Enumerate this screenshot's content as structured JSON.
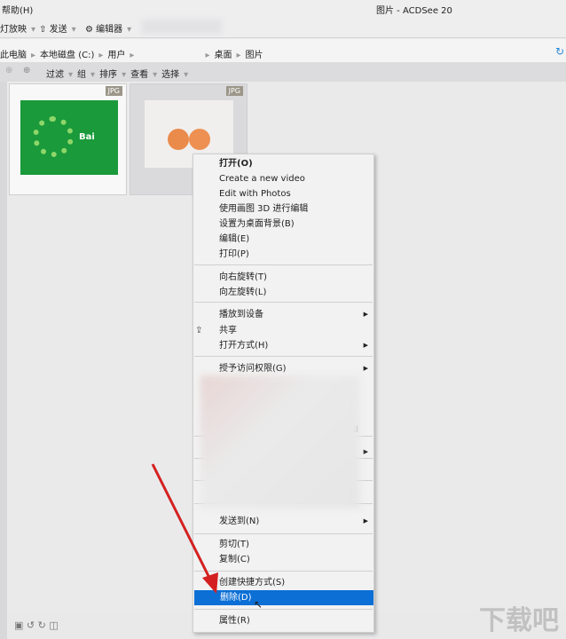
{
  "menubar": {
    "help": "帮助(H)",
    "title": "图片 - ACDSee 20"
  },
  "toolbar": {
    "slideshow": "灯放映",
    "send": "发送",
    "editor": "编辑器"
  },
  "breadcrumb": [
    "此电脑",
    "本地磁盘 (C:)",
    "用户",
    "桌面",
    "图片"
  ],
  "subtoolbar": [
    "过滤",
    "组",
    "排序",
    "查看",
    "选择"
  ],
  "thumbnails": [
    {
      "badge": "JPG",
      "logo": "Bai"
    },
    {
      "badge": "JPG"
    }
  ],
  "context_menu": {
    "items": [
      {
        "label": "打开(O)",
        "bold": true
      },
      {
        "label": "Create a new video"
      },
      {
        "label": "Edit with Photos"
      },
      {
        "label": "使用画图 3D 进行编辑"
      },
      {
        "label": "设置为桌面背景(B)"
      },
      {
        "label": "编辑(E)"
      },
      {
        "label": "打印(P)"
      },
      {
        "label": "向右旋转(T)"
      },
      {
        "label": "向左旋转(L)"
      },
      {
        "label": "播放到设备"
      },
      {
        "label": "共享"
      },
      {
        "label": "打开方式(H)"
      },
      {
        "label": "授予访问权限(G)"
      },
      {
        "label": "ail"
      },
      {
        "label": "发送到(N)"
      },
      {
        "label": "剪切(T)"
      },
      {
        "label": "复制(C)"
      },
      {
        "label": "创建快捷方式(S)"
      },
      {
        "label": "删除(D)"
      },
      {
        "label": "属性(R)"
      }
    ],
    "highlight_color": "#0b6fd6"
  },
  "watermark": "下载吧"
}
